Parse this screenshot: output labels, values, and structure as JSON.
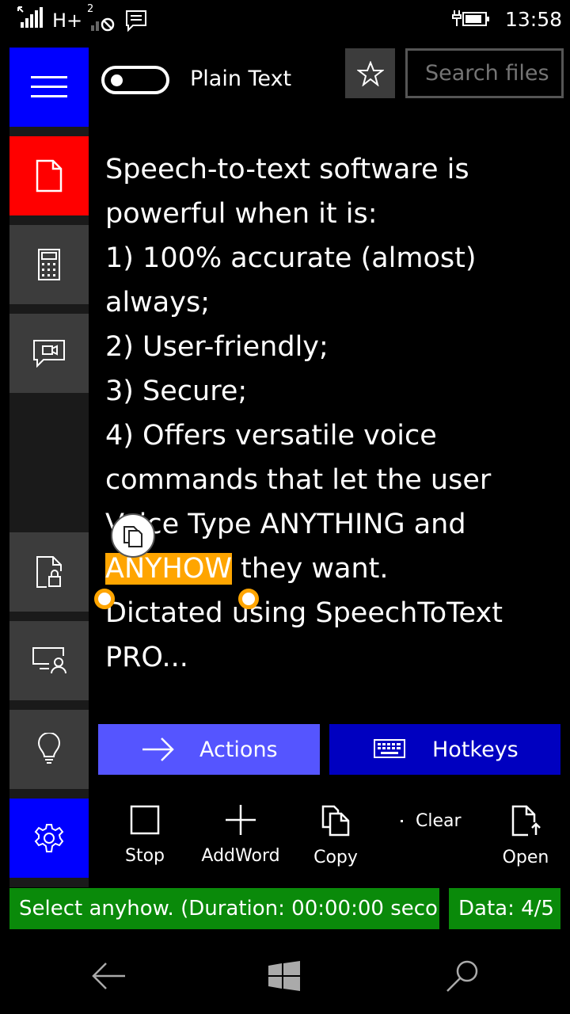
{
  "status_bar": {
    "network": "H+",
    "sim2": "2",
    "time": "13:58"
  },
  "header": {
    "toggle_label": "Plain Text",
    "search_placeholder": "Search files"
  },
  "document": {
    "lines_before": [
      "Speech-to-text software is",
      "powerful when it is:",
      "1) 100% accurate (almost)",
      "always;",
      "2) User-friendly;",
      "3) Secure;",
      "4) Offers versatile voice",
      "commands that let the user",
      "Voice Type ANYTHING and"
    ],
    "highlight": "ANYHOW",
    "highlight_rest": " they want.",
    "lines_after": [
      "Dictated using SpeechToText",
      "PRO..."
    ]
  },
  "buttons": {
    "actions": "Actions",
    "hotkeys": "Hotkeys"
  },
  "toolbar": {
    "stop": "Stop",
    "addword": "AddWord",
    "copy": "Copy",
    "clear": "Clear",
    "open": "Open"
  },
  "status_strip": {
    "message": "Select anyhow. (Duration: 00:00:00 seco",
    "data": "Data: 4/5"
  },
  "colors": {
    "accent_blue": "#0000ff",
    "highlight_orange": "#ffa500",
    "status_green": "#0a8a0a"
  }
}
